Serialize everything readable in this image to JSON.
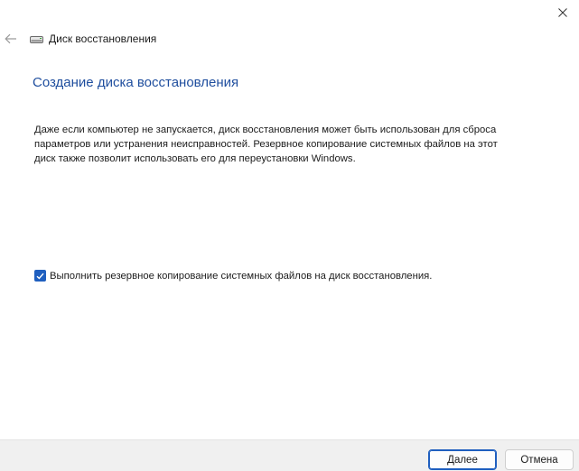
{
  "window": {
    "app_title": "Диск восстановления"
  },
  "icons": {
    "close": "close-icon",
    "back": "back-arrow-icon",
    "drive": "drive-icon",
    "checkmark": "checkmark-icon"
  },
  "content": {
    "page_title": "Создание диска восстановления",
    "description": "Даже если компьютер не запускается, диск восстановления может быть использован для сброса параметров или устранения неисправностей. Резервное копирование системных файлов на этот диск также позволит использовать его для переустановки Windows.",
    "backup_checkbox": {
      "label": "Выполнить резервное копирование системных файлов на диск восстановления.",
      "checked": true
    }
  },
  "footer": {
    "next_label": "Далее",
    "cancel_label": "Отмена"
  },
  "colors": {
    "accent": "#1f5fbf",
    "title": "#1f4e9e",
    "footer_bg": "#f0f0f0"
  }
}
